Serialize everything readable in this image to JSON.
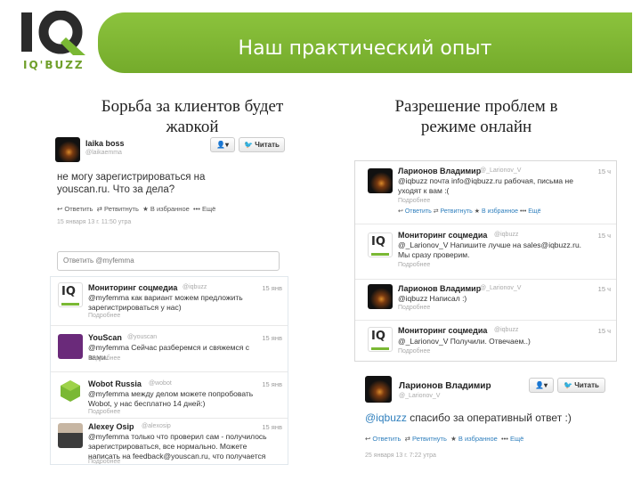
{
  "logo": {
    "mark": "IQ",
    "sub": "IQ'BUZZ"
  },
  "header": {
    "title": "Наш практический опыт"
  },
  "left_heading": "Борьба за клиентов будет жаркой",
  "right_heading": "Разрешение проблем в режиме онлайн",
  "left_tweet": {
    "name": "laika boss",
    "handle": "@laikaemma",
    "follow_btn": "Читать",
    "user_btn": "▾",
    "text": "не могу зарегистрироваться на youscan.ru. Что за дела?",
    "actions": [
      "Ответить",
      "Ретвитнуть",
      "В избранное",
      "Ещё"
    ],
    "date": "15 января 13 г. 11:50 утра",
    "reply_placeholder": "Ответить @myfemma"
  },
  "left_replies": [
    {
      "name": "Мониторинг соцмедиа",
      "handle": "@iqbuzz",
      "time": "15 янв",
      "text": "@myfemma как вариант можем предложить зарегистрироваться у нас)",
      "meta": "Подробнее"
    },
    {
      "name": "YouScan",
      "handle": "@youscan",
      "time": "15 янв",
      "text": "@myfemma Сейчас разберемся и свяжемся с вами.",
      "meta": "Подробнее"
    },
    {
      "name": "Wobot Russia",
      "handle": "@wobot",
      "time": "15 янв",
      "text": "@myfemma между делом можете попробовать Wobot, у нас бесплатно 14 дней:)",
      "meta": "Подробнее"
    },
    {
      "name": "Alexey Osip",
      "handle": "@alexosip",
      "time": "15 янв",
      "text": "@myfemma только что проверил сам - получилось зарегистрироваться, все нормально. Можете написать на feedback@youscan.ru, что получается",
      "meta": "Подробнее"
    }
  ],
  "right_thread": [
    {
      "name": "Ларионов Владимир",
      "handle": "@_Larionov_V",
      "time": "15 ч",
      "text": "@iqbuzz почта info@iqbuzz.ru рабочая, письма не уходят к вам :(",
      "meta": "Подробнее",
      "actions": [
        "Ответить",
        "Ретвитнуть",
        "В избранное",
        "Ещё"
      ]
    },
    {
      "name": "Мониторинг соцмедиа",
      "handle": "@iqbuzz",
      "time": "15 ч",
      "text": "@_Larionov_V Напишите лучше на sales@iqbuzz.ru. Мы сразу проверим.",
      "meta": "Подробнее"
    },
    {
      "name": "Ларионов Владимир",
      "handle": "@_Larionov_V",
      "time": "15 ч",
      "text": "@iqbuzz Написал :)",
      "meta": "Подробнее"
    },
    {
      "name": "Мониторинг соцмедиа",
      "handle": "@iqbuzz",
      "time": "15 ч",
      "text": "@_Larionov_V Получили. Отвечаем..)",
      "meta": "Подробнее"
    }
  ],
  "right_tweet": {
    "name": "Ларионов Владимир",
    "handle": "@_Larionov_V",
    "follow_btn": "Читать",
    "user_btn": "▾",
    "mention": "@iqbuzz",
    "text": " спасибо за оперативный ответ :)",
    "actions": [
      "Ответить",
      "Ретвитнуть",
      "В избранное",
      "Ещё"
    ],
    "date": "25 января 13 г. 7:22 утра"
  },
  "colors": {
    "banner_green": "#8cc33d",
    "link_blue": "#2f7fbd",
    "logo_green": "#6f9f2a"
  }
}
